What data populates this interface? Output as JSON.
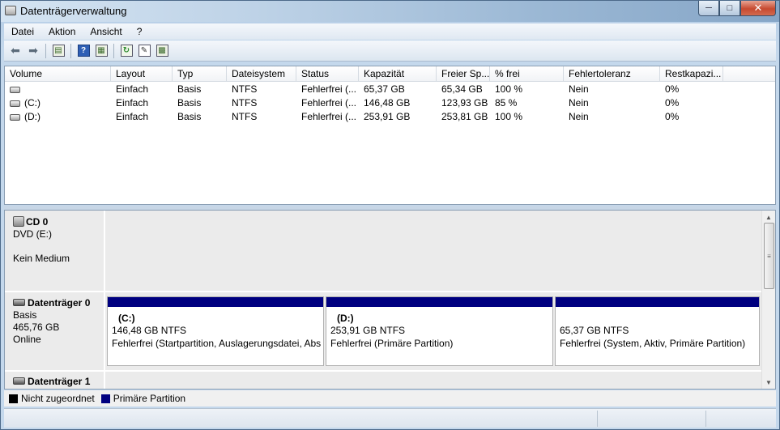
{
  "window": {
    "title": "Datenträgerverwaltung",
    "min_icon": "minimize-icon",
    "max_icon": "maximize-icon",
    "close_icon": "close-icon"
  },
  "menu": [
    "Datei",
    "Aktion",
    "Ansicht",
    "?"
  ],
  "toolbar": {
    "icons": [
      "back-arrow-icon",
      "forward-arrow-icon",
      "console-tree-icon",
      "help-icon",
      "action-pane-icon",
      "refresh-icon",
      "properties-icon",
      "export-list-icon"
    ]
  },
  "volume_list": {
    "columns": [
      "Volume",
      "Layout",
      "Typ",
      "Dateisystem",
      "Status",
      "Kapazität",
      "Freier Sp...",
      "% frei",
      "Fehlertoleranz",
      "Restkapazi..."
    ],
    "rows": [
      [
        "",
        "Einfach",
        "Basis",
        "NTFS",
        "Fehlerfrei (...",
        "65,37 GB",
        "65,34 GB",
        "100 %",
        "Nein",
        "0%"
      ],
      [
        "(C:)",
        "Einfach",
        "Basis",
        "NTFS",
        "Fehlerfrei (...",
        "146,48 GB",
        "123,93 GB",
        "85 %",
        "Nein",
        "0%"
      ],
      [
        "(D:)",
        "Einfach",
        "Basis",
        "NTFS",
        "Fehlerfrei (...",
        "253,91 GB",
        "253,81 GB",
        "100 %",
        "Nein",
        "0%"
      ]
    ]
  },
  "disks": {
    "cd0": {
      "name": "CD 0",
      "line1": "DVD (E:)",
      "line3": "Kein Medium"
    },
    "disk0": {
      "name": "Datenträger 0",
      "type": "Basis",
      "size": "465,76 GB",
      "state": "Online",
      "partitions": [
        {
          "label": "(C:)",
          "size": "146,48 GB NTFS",
          "status": "Fehlerfrei (Startpartition, Auslagerungsdatei, Abs"
        },
        {
          "label": "(D:)",
          "size": "253,91 GB NTFS",
          "status": "Fehlerfrei (Primäre Partition)"
        },
        {
          "label": "",
          "size": "65,37 GB NTFS",
          "status": "Fehlerfrei (System, Aktiv, Primäre Partition)"
        }
      ]
    },
    "disk1": {
      "name": "Datenträger 1"
    }
  },
  "legend": {
    "unallocated": "Nicht zugeordnet",
    "primary": "Primäre Partition",
    "colors": {
      "unallocated": "#000000",
      "primary": "#000080"
    }
  }
}
